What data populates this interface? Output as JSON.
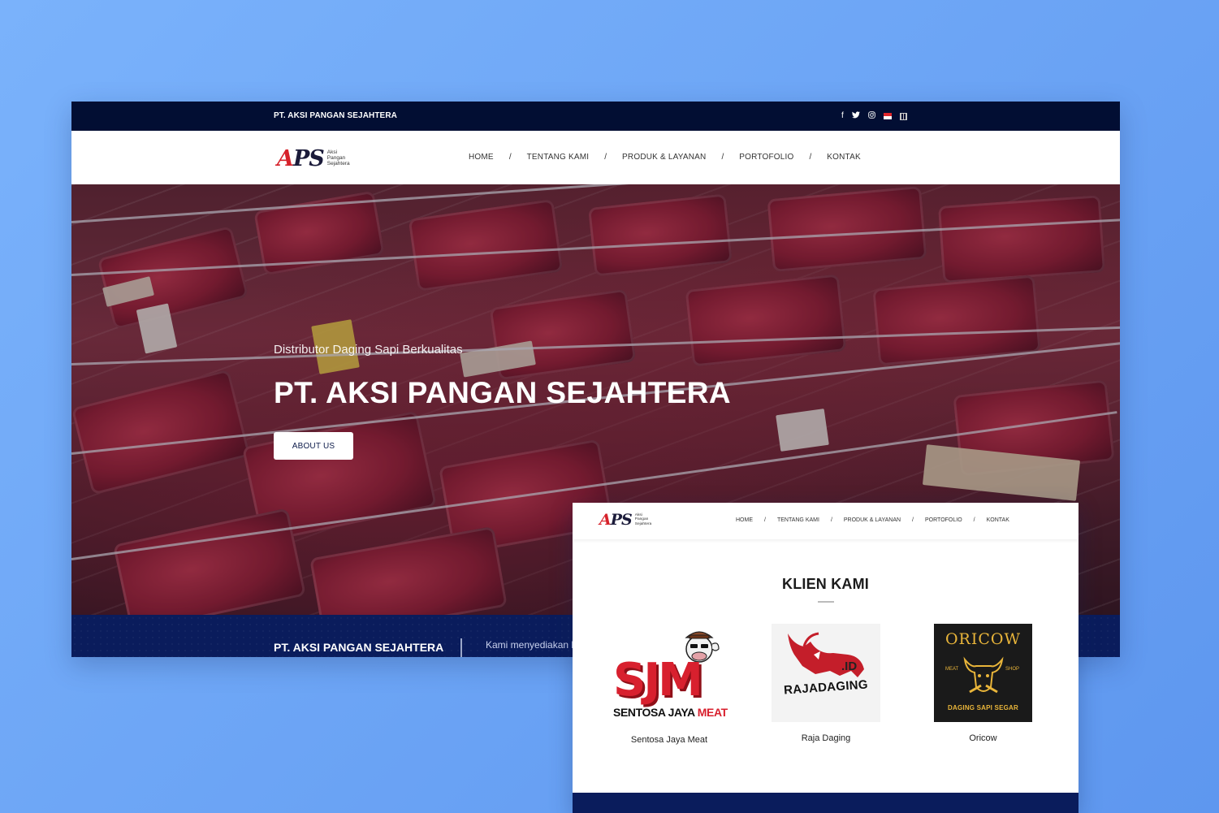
{
  "main": {
    "topbar": {
      "brand": "PT. AKSI PANGAN SEJAHTERA",
      "social_icons": [
        "facebook-icon",
        "twitter-icon",
        "instagram-icon",
        "flag-indonesia-icon",
        "flag-china-icon"
      ]
    },
    "logo": {
      "mark_a": "A",
      "mark_ps": "PS",
      "tagline": [
        "Aksi",
        "Pangan",
        "Sejahtera"
      ]
    },
    "nav": {
      "items": [
        "HOME",
        "TENTANG KAMI",
        "PRODUK & LAYANAN",
        "PORTOFOLIO",
        "KONTAK"
      ],
      "separator": "/"
    },
    "hero": {
      "subtitle": "Distributor Daging Sapi Berkualitas",
      "title": "PT. AKSI PANGAN SEJAHTERA",
      "button": "ABOUT US"
    },
    "band": {
      "name": "PT. AKSI PANGAN SEJAHTERA",
      "description": "Kami menyediakan k"
    }
  },
  "overlay": {
    "logo": {
      "mark_a": "A",
      "mark_ps": "PS",
      "tagline": [
        "Aksi",
        "Pangan",
        "Sejahtera"
      ]
    },
    "nav": {
      "items": [
        "HOME",
        "TENTANG KAMI",
        "PRODUK & LAYANAN",
        "PORTOFOLIO",
        "KONTAK"
      ],
      "separator": "/"
    },
    "section_title": "KLIEN KAMI",
    "clients": [
      {
        "name": "Sentosa Jaya Meat",
        "logo_text": "SJM",
        "logo_sub_a": "SENTOSA JAYA ",
        "logo_sub_b": "MEAT"
      },
      {
        "name": "Raja Daging",
        "logo_text": "RAJADAGING",
        "logo_suffix": ".ID"
      },
      {
        "name": "Oricow",
        "logo_text": "ORICOW",
        "logo_left": "MEAT",
        "logo_right": "SHOP",
        "logo_bottom": "DAGING SAPI SEGAR"
      }
    ]
  },
  "colors": {
    "background": "#6fa6f5",
    "navy": "#020e33",
    "band": "#0a1c5c",
    "brand_red": "#d6222b",
    "oricow_gold": "#e9b53a"
  }
}
